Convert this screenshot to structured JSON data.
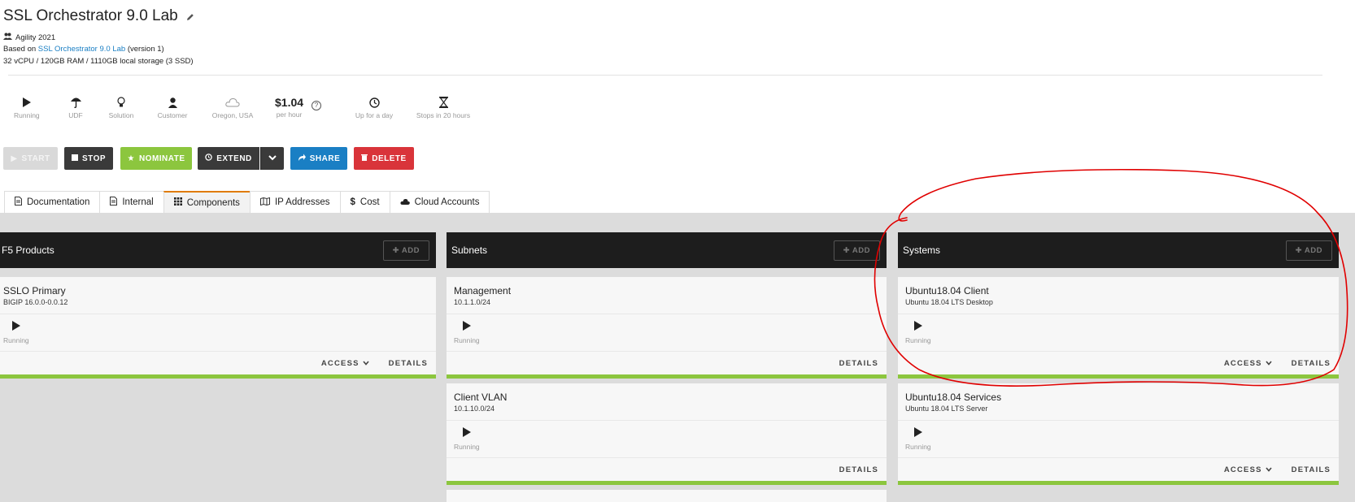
{
  "header": {
    "title": "SSL Orchestrator 9.0 Lab",
    "group": "Agility 2021",
    "based_on_prefix": "Based on",
    "based_on_link": "SSL Orchestrator 9.0 Lab",
    "based_on_suffix": "(version 1)",
    "specs": "32 vCPU / 120GB RAM / 1110GB local storage (3 SSD)"
  },
  "stats": {
    "state": "Running",
    "platform": "UDF",
    "type": "Solution",
    "owner": "Customer",
    "region": "Oregon, USA",
    "price": "$1.04",
    "price_unit": "per hour",
    "uptime": "Up for a day",
    "stops": "Stops in 20 hours"
  },
  "actions": {
    "start": "START",
    "stop": "STOP",
    "nominate": "NOMINATE",
    "extend": "EXTEND",
    "share": "SHARE",
    "delete": "DELETE"
  },
  "tabs": [
    "Documentation",
    "Internal",
    "Components",
    "IP Addresses",
    "Cost",
    "Cloud Accounts"
  ],
  "columns": {
    "products": {
      "title": "F5 Products",
      "add": "ADD",
      "cards": [
        {
          "name": "SSLO Primary",
          "sub": "BIGIP 16.0.0-0.0.12",
          "state": "Running",
          "access": "ACCESS",
          "details": "DETAILS"
        }
      ]
    },
    "subnets": {
      "title": "Subnets",
      "add": "ADD",
      "cards": [
        {
          "name": "Management",
          "sub": "10.1.1.0/24",
          "state": "Running",
          "details": "DETAILS"
        },
        {
          "name": "Client VLAN",
          "sub": "10.1.10.0/24",
          "state": "Running",
          "details": "DETAILS"
        }
      ]
    },
    "systems": {
      "title": "Systems",
      "add": "ADD",
      "cards": [
        {
          "name": "Ubuntu18.04 Client",
          "sub": "Ubuntu 18.04 LTS Desktop",
          "state": "Running",
          "access": "ACCESS",
          "details": "DETAILS"
        },
        {
          "name": "Ubuntu18.04 Services",
          "sub": "Ubuntu 18.04 LTS Server",
          "state": "Running",
          "access": "ACCESS",
          "details": "DETAILS"
        }
      ]
    }
  },
  "colors": {
    "accent_green": "#8cc63e",
    "dark": "#1d1d1d",
    "share_blue": "#1a7fc4",
    "delete_red": "#d9343a",
    "annotation_red": "#e00000"
  }
}
